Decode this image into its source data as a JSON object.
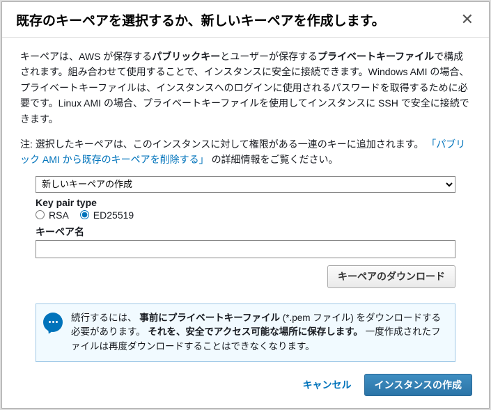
{
  "header": {
    "title": "既存のキーペアを選択するか、新しいキーペアを作成します。"
  },
  "description": {
    "p1a": "キーペアは、AWS が保存する",
    "p1b": "パブリックキー",
    "p1c": "とユーザーが保存する",
    "p1d": "プライベートキーファイル",
    "p1e": "で構成されます。組み合わせて使用することで、インスタンスに安全に接続できます。Windows AMI の場合、プライベートキーファイルは、インスタンスへのログインに使用されるパスワードを取得するために必要です。Linux AMI の場合、プライベートキーファイルを使用してインスタンスに SSH で安全に接続できます。"
  },
  "note": {
    "prefix": "注: 選択したキーペアは、このインスタンスに対して権限がある一連のキーに追加されます。",
    "link": "「パブリック AMI から既存のキーペアを削除する」",
    "suffix": "の詳細情報をご覧ください。"
  },
  "form": {
    "select_value": "新しいキーペアの作成",
    "kp_type_label": "Key pair type",
    "radio_rsa": "RSA",
    "radio_ed": "ED25519",
    "kp_name_label": "キーペア名",
    "kp_name_value": "",
    "download_btn": "キーペアのダウンロード"
  },
  "info": {
    "t1": "続行するには、",
    "t2": "事前にプライベートキーファイル",
    "t3": " (*.pem ファイル) をダウンロードする必要があります。",
    "t4": "それを、安全でアクセス可能な場所に保存します。",
    "t5": "一度作成されたファイルは再度ダウンロードすることはできなくなります。"
  },
  "footer": {
    "cancel": "キャンセル",
    "launch": "インスタンスの作成"
  }
}
